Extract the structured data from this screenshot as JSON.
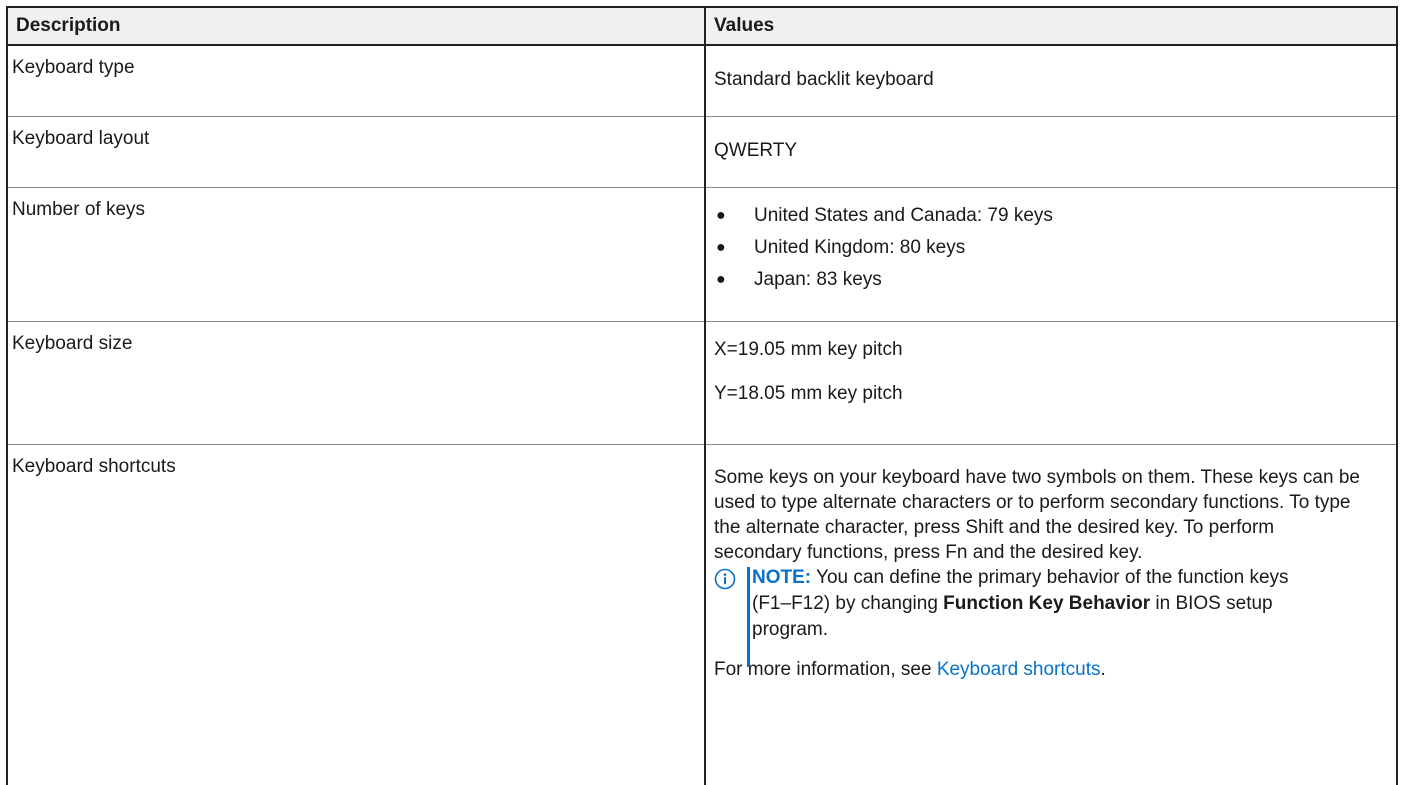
{
  "table": {
    "header": {
      "description": "Description",
      "values": "Values"
    },
    "rows": {
      "keyboard_type": {
        "label": "Keyboard type",
        "value": "Standard backlit keyboard"
      },
      "keyboard_layout": {
        "label": "Keyboard layout",
        "value": "QWERTY"
      },
      "number_of_keys": {
        "label": "Number of keys",
        "bullet": "●",
        "items": [
          "United States and Canada: 79 keys",
          "United Kingdom: 80 keys",
          "Japan: 83 keys"
        ]
      },
      "keyboard_size": {
        "label": "Keyboard size",
        "x_pitch": "X=19.05 mm key pitch",
        "y_pitch": "Y=18.05 mm key pitch"
      },
      "keyboard_shortcuts": {
        "label": "Keyboard shortcuts",
        "paragraph": "Some keys on your keyboard have two symbols on them. These keys can be used to type alternate characters or to perform secondary functions. To type the alternate character, press Shift and the desired key. To perform secondary functions, press Fn and the desired key.",
        "note": {
          "icon": "info-icon",
          "label": "NOTE:",
          "text_before": " You can define the primary behavior of the function keys (F1–F12) by changing ",
          "bold_term": "Function Key Behavior",
          "text_after": " in BIOS setup program."
        },
        "more_prefix": "For more information, see ",
        "more_link": "Keyboard shortcuts",
        "more_suffix": "."
      }
    }
  },
  "colors": {
    "header_bg": "#f0f0f0",
    "link": "#0672cb",
    "note_accent": "#0672cb",
    "border": "#222222"
  }
}
